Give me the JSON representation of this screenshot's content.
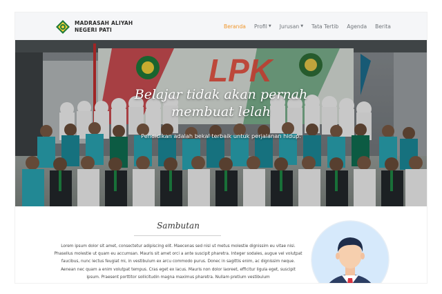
{
  "brand": {
    "name_line1": "MADRASAH ALIYAH",
    "name_line2": "NEGERI PATI"
  },
  "nav": {
    "items": [
      {
        "label": "Beranda",
        "active": true,
        "dropdown": false
      },
      {
        "label": "Profil",
        "active": false,
        "dropdown": true
      },
      {
        "label": "Jurusan",
        "active": false,
        "dropdown": true
      },
      {
        "label": "Tata Tertib",
        "active": false,
        "dropdown": false
      },
      {
        "label": "Agenda",
        "active": false,
        "dropdown": false
      },
      {
        "label": "Berita",
        "active": false,
        "dropdown": false
      }
    ],
    "active_color": "#f0962a",
    "caret_icon": "chevron-down-icon"
  },
  "hero": {
    "title_line1": "Belajar tidak akan pernah",
    "title_line2": "membuat lelah",
    "subtitle": "Pendidikan adalah bekal terbaik untuk perjalanan hidup.",
    "banner_text": "LPK"
  },
  "sambutan": {
    "title": "Sambutan",
    "body": "Lorem ipsum dolor sit amet, consectetur adipiscing elit. Maecenas sed nisl ut metus molestie dignissim eu vitae nisi. Phasellus molestie ut quam eu accumsan. Mauris sit amet orci a ante suscipit pharetra. Integer sodales, augue vel volutpat faucibus, nunc lectus feugiat mi, in vestibulum ex arcu commodo purus. Donec in sagittis enim, ac dignissim neque. Aenean nec quam a enim volutpat tempus. Cras eget ex lacus. Mauris non dolor laoreet, efficitur ligula eget, suscipit ipsum. Praesent porttitor sollicitudin magna maximus pharetra. Nullam pretium vestibulum"
  }
}
